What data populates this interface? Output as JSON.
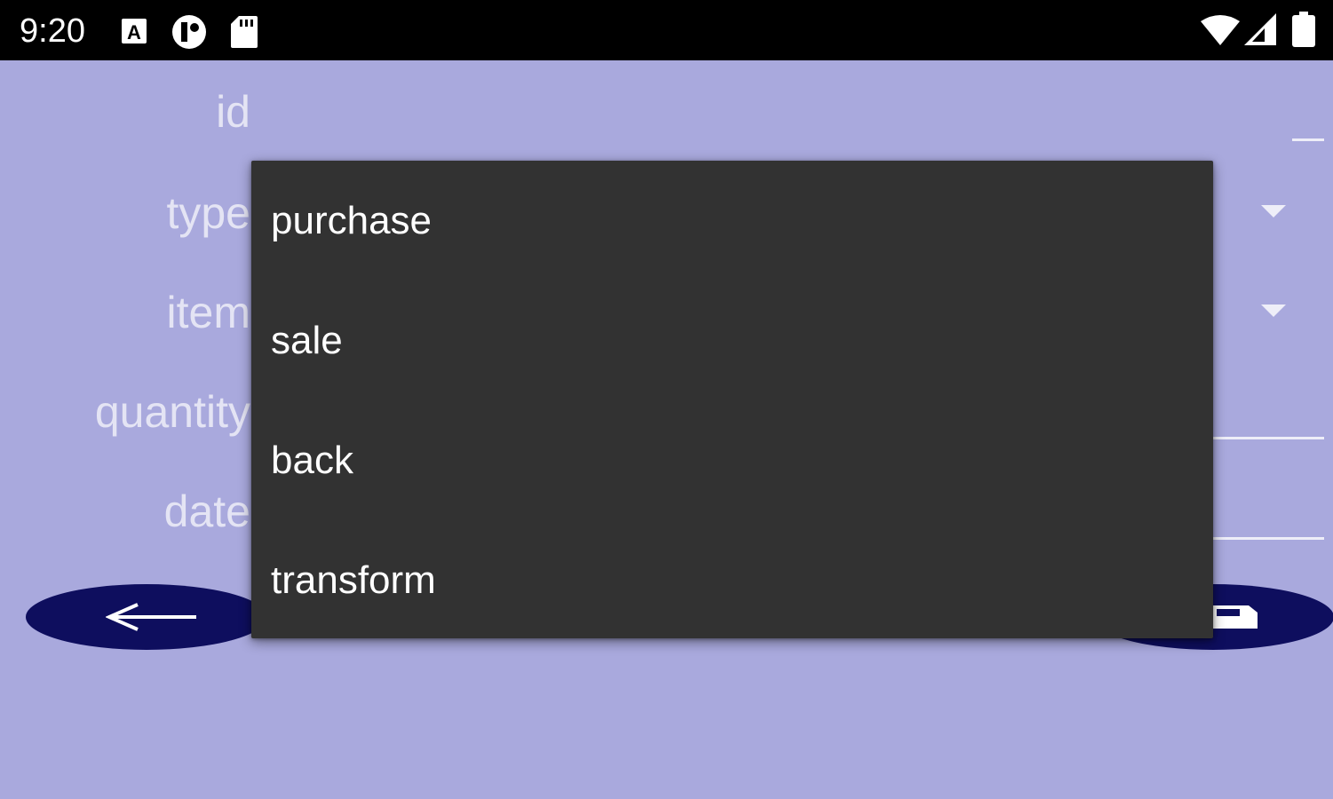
{
  "status_bar": {
    "time": "9:20",
    "icons": [
      "keyboard-a-icon",
      "app-notification-icon",
      "sd-card-icon",
      "wifi-icon",
      "signal-icon",
      "battery-icon"
    ]
  },
  "form": {
    "labels": {
      "id": "id",
      "type": "type",
      "item": "item",
      "quantity": "quantity",
      "date": "date"
    }
  },
  "dropdown": {
    "options": [
      "purchase",
      "sale",
      "back",
      "transform"
    ]
  },
  "buttons": {
    "back_icon": "arrow-left-icon",
    "save_icon": "save-icon"
  },
  "colors": {
    "background": "#a9a9dd",
    "status_bar": "#000000",
    "label_text": "#e4e4f4",
    "dropdown_bg": "#323232",
    "dropdown_text": "#ffffff",
    "fab": "#0e0e5e"
  }
}
